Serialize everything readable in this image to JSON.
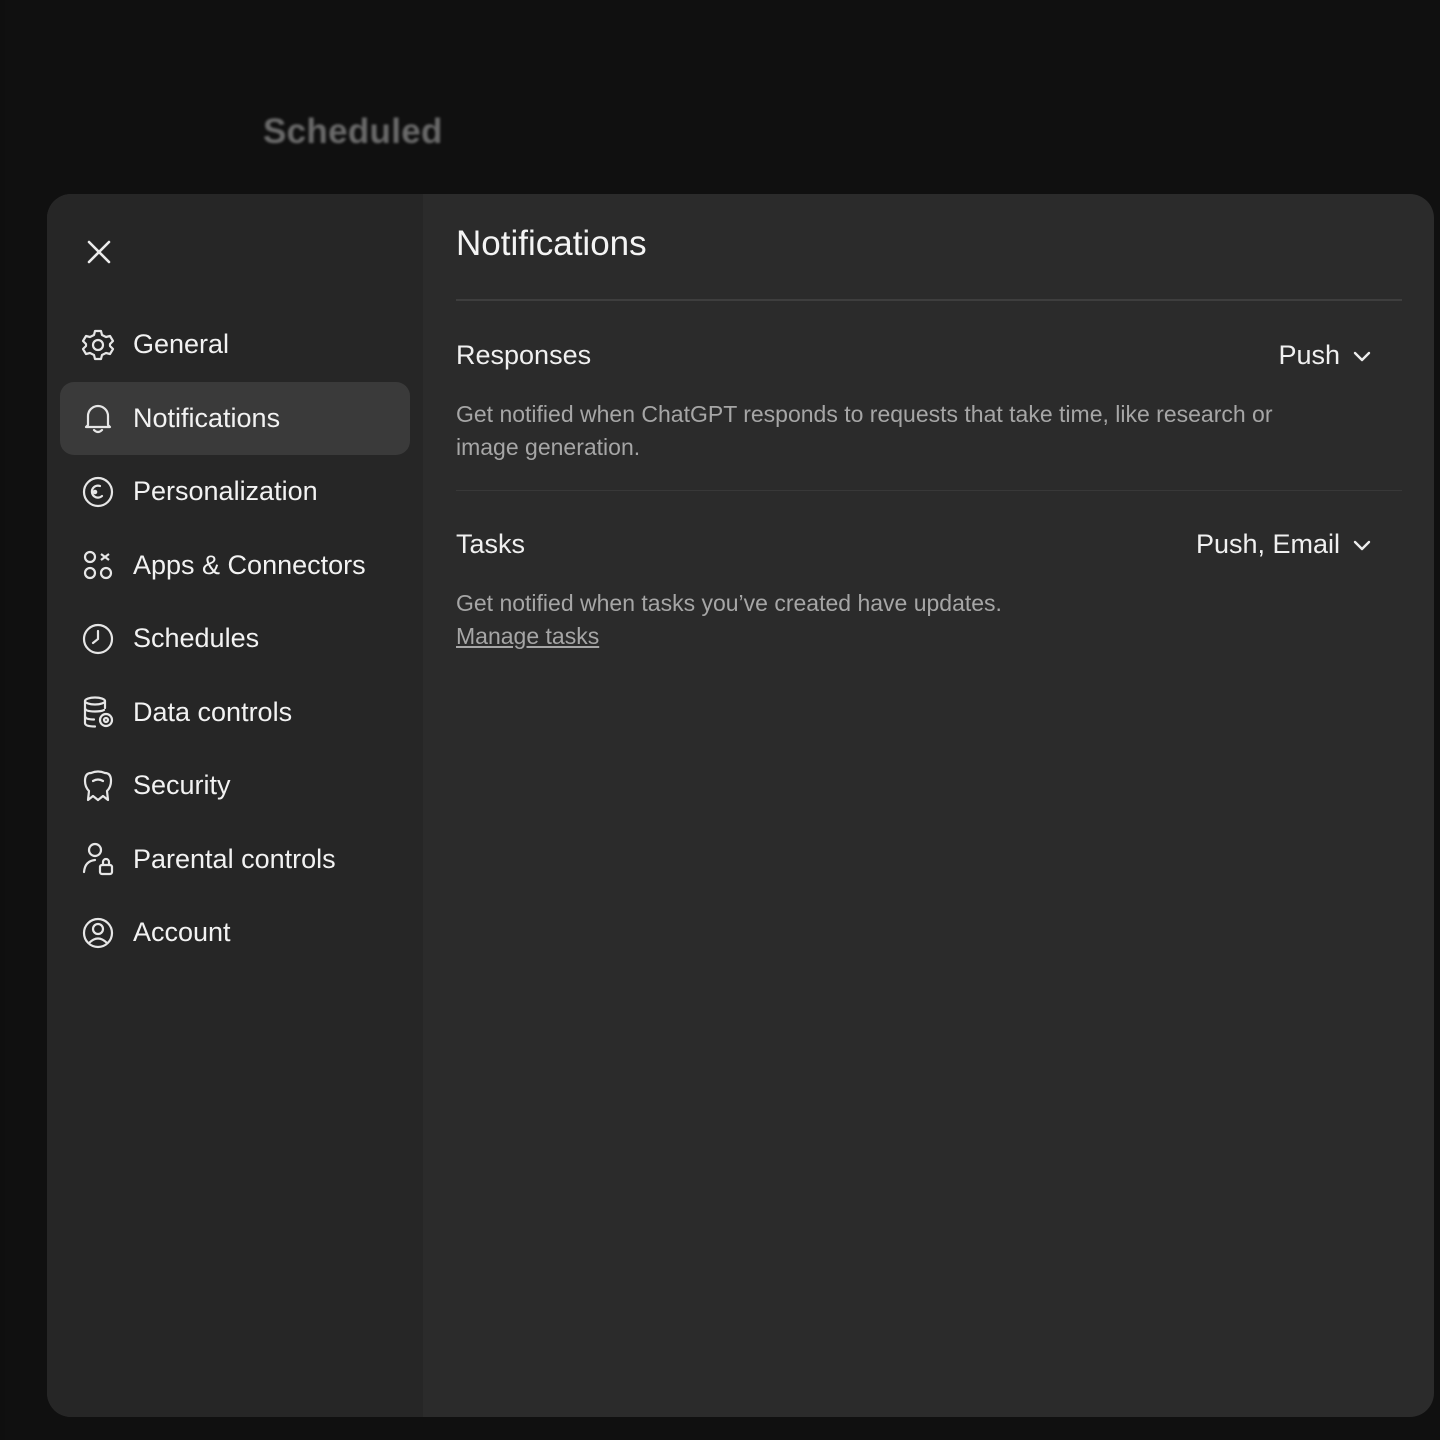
{
  "background": {
    "title": "Scheduled"
  },
  "colors": {
    "page_background": "#101010",
    "modal_background": "#2b2b2b",
    "sidebar_background": "#262626",
    "active_item_background": "#3a3a3a",
    "text_primary": "#f0f0f0",
    "text_secondary": "#a6a6a6"
  },
  "modal": {
    "close_icon": "close-icon",
    "sidebar": {
      "items": [
        {
          "label": "General",
          "icon": "gear-icon",
          "active": false
        },
        {
          "label": "Notifications",
          "icon": "bell-icon",
          "active": true
        },
        {
          "label": "Personalization",
          "icon": "personalization-icon",
          "active": false
        },
        {
          "label": "Apps & Connectors",
          "icon": "apps-icon",
          "active": false
        },
        {
          "label": "Schedules",
          "icon": "clock-icon",
          "active": false
        },
        {
          "label": "Data controls",
          "icon": "database-icon",
          "active": false
        },
        {
          "label": "Security",
          "icon": "security-icon",
          "active": false
        },
        {
          "label": "Parental controls",
          "icon": "parental-icon",
          "active": false
        },
        {
          "label": "Account",
          "icon": "account-icon",
          "active": false
        }
      ]
    },
    "content": {
      "title": "Notifications",
      "responses": {
        "title": "Responses",
        "value": "Push",
        "description": "Get notified when ChatGPT responds to requests that take time, like research or image generation."
      },
      "tasks": {
        "title": "Tasks",
        "value": "Push, Email",
        "description": "Get notified when tasks you’ve created have updates.",
        "link": "Manage tasks"
      }
    }
  }
}
